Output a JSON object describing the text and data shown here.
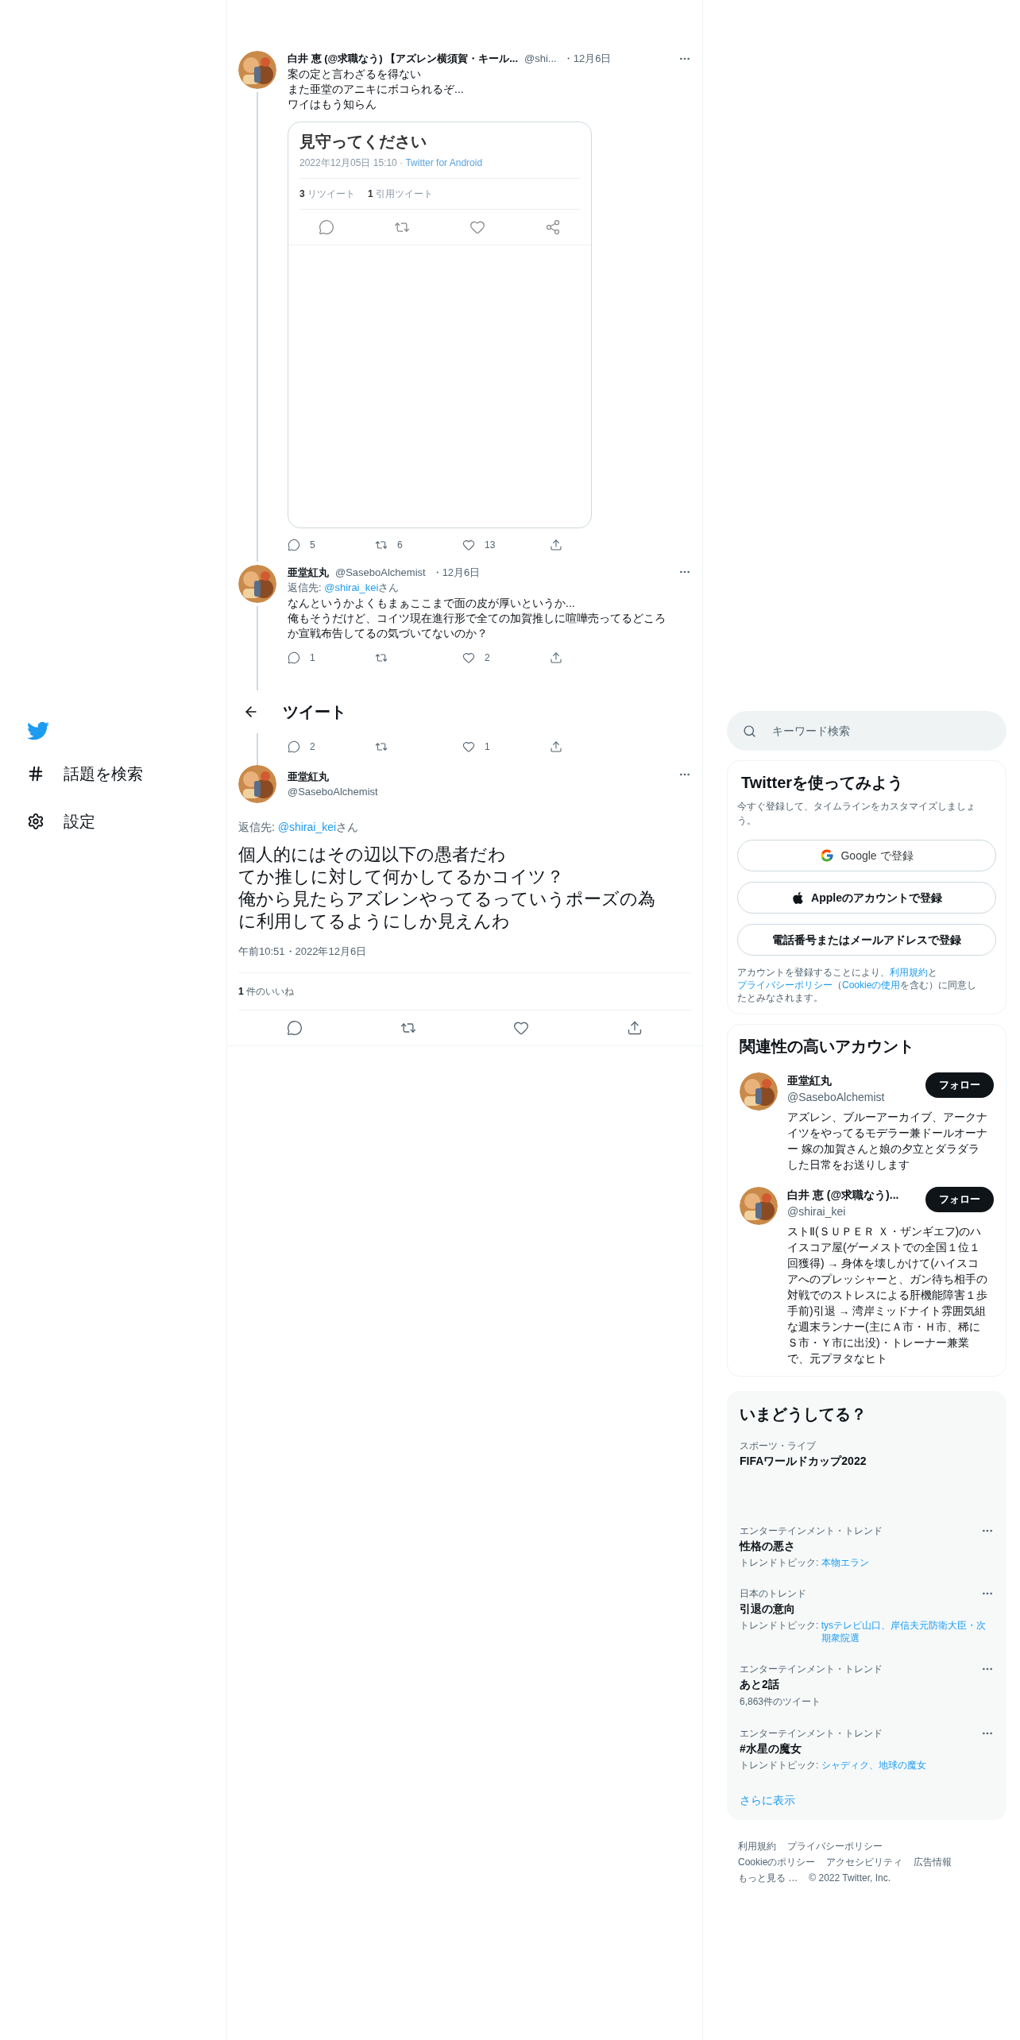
{
  "sidebar": {
    "items": [
      {
        "kind": "explore",
        "label": "話題を検索"
      },
      {
        "kind": "settings",
        "label": "設定"
      }
    ]
  },
  "thread": [
    {
      "name": "白井 恵 (@求職なう) 【アズレン横須賀・キール...",
      "handle": "@shi...",
      "date": "・12月6日",
      "lines": [
        "案の定と言わざるを得ない",
        "また亜堂のアニキにボコられるぞ...",
        "ワイはもう知らん"
      ],
      "media": {
        "title": "見守ってください",
        "meta": "2022年12月05日 15:10 · ",
        "source": "Twitter for Android",
        "stats": [
          {
            "count": "3",
            "label": "リツイート"
          },
          {
            "count": "1",
            "label": "引用ツイート"
          }
        ]
      },
      "actions": [
        {
          "kind": "reply",
          "count": "5"
        },
        {
          "kind": "retweet",
          "count": "6"
        },
        {
          "kind": "like",
          "count": "13"
        },
        {
          "kind": "share"
        }
      ]
    },
    {
      "name": "亜堂紅丸",
      "handle": "@SaseboAlchemist",
      "date": "・12月6日",
      "reply_to": {
        "label": "返信先: ",
        "user": "@shirai_kei",
        "suffix": "さん"
      },
      "lines": [
        "なんというかよくもまぁここまで面の皮が厚いというか...",
        "俺もそうだけど、コイツ現在進行形で全ての加賀推しに喧嘩売ってるどころか宣戦布告してるの気づいてないのか？"
      ],
      "actions": [
        {
          "kind": "reply",
          "count": "1"
        },
        {
          "kind": "retweet"
        },
        {
          "kind": "like",
          "count": "2"
        },
        {
          "kind": "share"
        }
      ]
    }
  ],
  "header": {
    "title": "ツイート"
  },
  "hidden_tweet_actions": [
    {
      "kind": "reply",
      "count": "2"
    },
    {
      "kind": "retweet"
    },
    {
      "kind": "like",
      "count": "1"
    },
    {
      "kind": "share"
    }
  ],
  "main_tweet": {
    "name": "亜堂紅丸",
    "handle": "@SaseboAlchemist",
    "reply_to": {
      "label": "返信先: ",
      "user": "@shirai_kei",
      "suffix": "さん"
    },
    "lines": [
      "個人的にはその辺以下の愚者だわ",
      "てか推しに対して何かしてるかコイツ？",
      "俺から見たらアズレンやってるっていうポーズの為に利用してるようにしか見えんわ"
    ],
    "timestamp": "午前10:51・2022年12月6日",
    "likes": {
      "count": "1",
      "label": " 件のいいね"
    },
    "actions": [
      {
        "kind": "reply"
      },
      {
        "kind": "retweet"
      },
      {
        "kind": "like"
      },
      {
        "kind": "share"
      }
    ]
  },
  "search": {
    "placeholder": "キーワード検索"
  },
  "signup": {
    "title": "Twitterを使ってみよう",
    "subtitle": "今すぐ登録して、タイムラインをカスタマイズしましょう。",
    "buttons": [
      {
        "kind": "google",
        "label": "Google で登録"
      },
      {
        "kind": "apple",
        "label": "Appleのアカウントで登録"
      },
      {
        "kind": "phone",
        "label": "電話番号またはメールアドレスで登録"
      }
    ],
    "legal": [
      {
        "text": "アカウントを登録することにより、",
        "link": false
      },
      {
        "text": "利用規約",
        "link": true
      },
      {
        "text": "と",
        "link": false
      },
      {
        "text": "プライバシーポリシー",
        "link": true
      },
      {
        "text": "（",
        "link": false
      },
      {
        "text": "Cookieの使用",
        "link": true
      },
      {
        "text": "を含む）に同意したとみなされます。",
        "link": false
      }
    ]
  },
  "who_to_follow": {
    "title": "関連性の高いアカウント",
    "accounts": [
      {
        "name": "亜堂紅丸",
        "handle": "@SaseboAlchemist",
        "bio": "アズレン、ブルーアーカイブ、アークナイツをやってるモデラー兼ドールオーナー 嫁の加賀さんと娘の夕立とダラダラした日常をお送りします",
        "button": "フォロー"
      },
      {
        "name": "白井 恵 (@求職なう)...",
        "handle": "@shirai_kei",
        "bio": "ストⅡ(ＳＵＰＥＲ Ｘ・ザンギエフ)のハイスコア屋(ゲーメストでの全国１位１回獲得) → 身体を壊しかけて(ハイスコアへのプレッシャーと、ガン待ち相手の対戦でのストレスによる肝機能障害１歩手前)引退 → 湾岸ミッドナイト雰囲気組な週末ランナー(主にＡ市・Ｈ市、稀にＳ市・Ｙ市に出没)・トレーナー兼業で、元プヲタなヒト",
        "button": "フォロー"
      }
    ]
  },
  "trends": {
    "title": "いまどうしてる？",
    "items": [
      {
        "category": "スポーツ・ライブ",
        "title": "FIFAワールドカップ2022",
        "more": false
      },
      {
        "category": "エンターテインメント・トレンド",
        "title": "性格の悪さ",
        "more": true,
        "topic": {
          "label": "トレンドトピック: ",
          "links": "本物エラン"
        }
      },
      {
        "category": "日本のトレンド",
        "title": "引退の意向",
        "more": true,
        "topic": {
          "label": "トレンドトピック: ",
          "links": "tysテレビ山口、岸信夫元防衛大臣・次期衆院選"
        }
      },
      {
        "category": "エンターテインメント・トレンド",
        "title": "あと2話",
        "more": true,
        "count": "6,863件のツイート"
      },
      {
        "category": "エンターテインメント・トレンド",
        "title": "#水星の魔女",
        "more": true,
        "topic": {
          "label": "トレンドトピック: ",
          "links": "シャディク、地球の魔女"
        }
      }
    ],
    "show_more": "さらに表示"
  },
  "footer": [
    "利用規約",
    "プライバシーポリシー",
    "Cookieのポリシー",
    "アクセシビリティ",
    "広告情報",
    "もっと見る …",
    "© 2022 Twitter, Inc."
  ]
}
